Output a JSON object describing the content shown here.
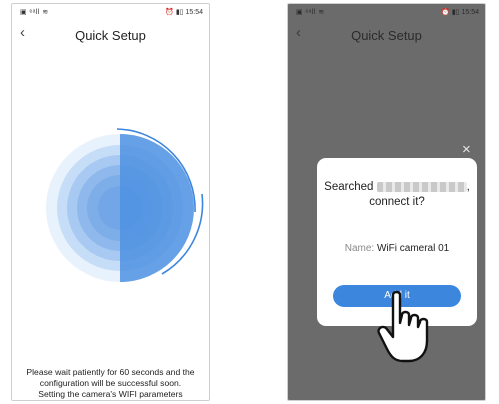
{
  "left_screen": {
    "status_left": "▣ ᵉᵃll ≋",
    "status_right": "⏰ ▮▯ 15:54",
    "back_icon": "‹",
    "title": "Quick Setup",
    "message_lines": [
      "Please wait patiently for 60 seconds and the",
      "configuration will be successful soon.",
      "Setting the camera's WIFI parameters"
    ]
  },
  "right_screen": {
    "status_left": "▣ ᵉᵃll ≋",
    "status_right": "⏰ ▮▯ 15:54",
    "back_icon": "‹",
    "title": "Quick Setup",
    "close_icon": "×",
    "dialog": {
      "searched_prefix": "Searched",
      "searched_suffix": ",",
      "question": "connect it?",
      "name_label": "Name:",
      "name_value": "WiFi cameral 01",
      "button_label": "Add it"
    }
  },
  "colors": {
    "accent_blue": "#3d86dd",
    "overlay_gray": "#6b6b6b"
  }
}
